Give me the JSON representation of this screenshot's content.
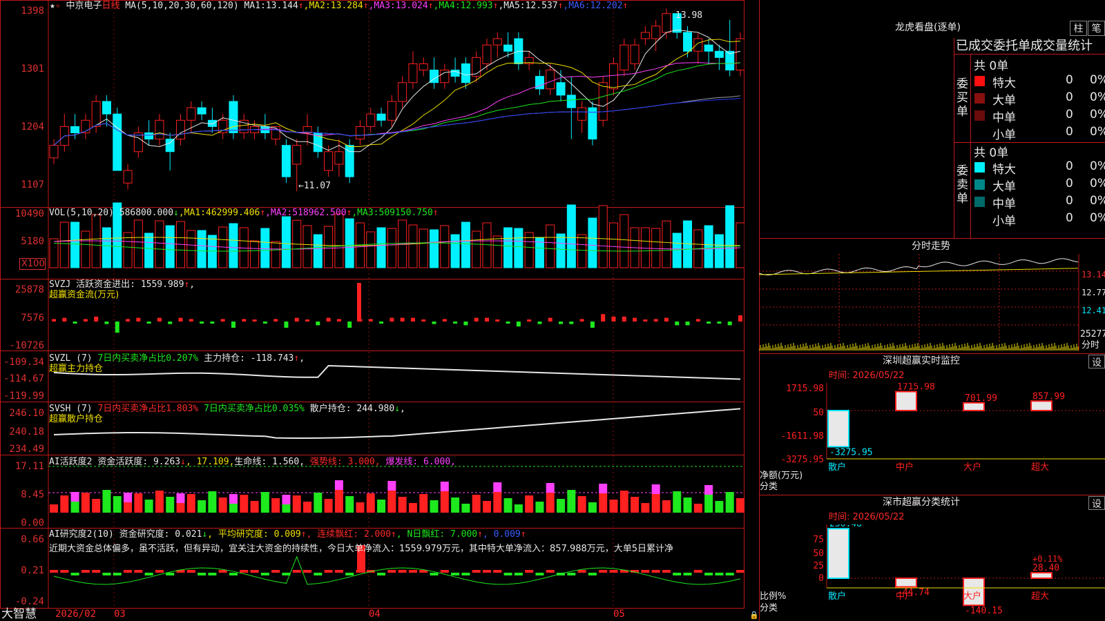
{
  "kline": {
    "stock_name": "中京电子",
    "period": "日线",
    "ma_label": "MA(5,10,20,30,60,120)",
    "ma": [
      {
        "name": "MA1",
        "value": "13.144"
      },
      {
        "name": "MA2",
        "value": "13.284"
      },
      {
        "name": "MA3",
        "value": "13.024"
      },
      {
        "name": "MA4",
        "value": "12.993"
      },
      {
        "name": "MA5",
        "value": "12.537"
      },
      {
        "name": "MA6",
        "value": "12.202"
      }
    ],
    "yticks": [
      "1398",
      "1301",
      "1204",
      "1107"
    ],
    "high_label": "13.98",
    "low_label": "←11.07",
    "candles": [
      {
        "o": 11.6,
        "h": 11.9,
        "l": 11.5,
        "c": 11.8
      },
      {
        "o": 11.8,
        "h": 12.3,
        "l": 11.7,
        "c": 12.1
      },
      {
        "o": 12.1,
        "h": 12.3,
        "l": 11.9,
        "c": 12.0
      },
      {
        "o": 12.0,
        "h": 12.3,
        "l": 11.9,
        "c": 12.2
      },
      {
        "o": 12.1,
        "h": 12.6,
        "l": 12.0,
        "c": 12.5
      },
      {
        "o": 12.5,
        "h": 12.6,
        "l": 12.1,
        "c": 12.3
      },
      {
        "o": 12.3,
        "h": 12.4,
        "l": 11.5,
        "c": 11.4
      },
      {
        "o": 11.2,
        "h": 11.5,
        "l": 11.1,
        "c": 11.4
      },
      {
        "o": 11.7,
        "h": 12.1,
        "l": 11.6,
        "c": 12.0
      },
      {
        "o": 12.0,
        "h": 12.2,
        "l": 11.8,
        "c": 11.9
      },
      {
        "o": 11.9,
        "h": 12.3,
        "l": 11.8,
        "c": 12.2
      },
      {
        "o": 11.9,
        "h": 12.0,
        "l": 11.4,
        "c": 11.7
      },
      {
        "o": 11.9,
        "h": 12.3,
        "l": 11.8,
        "c": 12.2
      },
      {
        "o": 12.2,
        "h": 12.5,
        "l": 12.0,
        "c": 12.4
      },
      {
        "o": 12.4,
        "h": 12.5,
        "l": 12.2,
        "c": 12.3
      },
      {
        "o": 12.2,
        "h": 12.4,
        "l": 12.0,
        "c": 12.1
      },
      {
        "o": 12.0,
        "h": 12.3,
        "l": 11.9,
        "c": 12.2
      },
      {
        "o": 12.5,
        "h": 12.6,
        "l": 11.9,
        "c": 12.0
      },
      {
        "o": 12.0,
        "h": 12.3,
        "l": 11.9,
        "c": 12.2
      },
      {
        "o": 12.0,
        "h": 12.2,
        "l": 11.9,
        "c": 12.1
      },
      {
        "o": 12.1,
        "h": 12.3,
        "l": 11.9,
        "c": 12.0
      },
      {
        "o": 11.9,
        "h": 12.1,
        "l": 11.8,
        "c": 12.1
      },
      {
        "o": 11.8,
        "h": 11.9,
        "l": 11.2,
        "c": 11.3
      },
      {
        "o": 11.5,
        "h": 11.9,
        "l": 11.07,
        "c": 11.8
      },
      {
        "o": 12.0,
        "h": 12.3,
        "l": 11.8,
        "c": 12.1
      },
      {
        "o": 12.0,
        "h": 12.1,
        "l": 11.6,
        "c": 11.7
      },
      {
        "o": 11.4,
        "h": 11.8,
        "l": 11.3,
        "c": 11.7
      },
      {
        "o": 11.5,
        "h": 11.9,
        "l": 11.3,
        "c": 11.7
      },
      {
        "o": 11.8,
        "h": 11.9,
        "l": 11.2,
        "c": 11.3
      },
      {
        "o": 11.9,
        "h": 12.2,
        "l": 11.8,
        "c": 12.1
      },
      {
        "o": 12.1,
        "h": 12.4,
        "l": 12.0,
        "c": 12.3
      },
      {
        "o": 12.3,
        "h": 12.4,
        "l": 12.1,
        "c": 12.2
      },
      {
        "o": 12.2,
        "h": 12.6,
        "l": 12.1,
        "c": 12.5
      },
      {
        "o": 12.5,
        "h": 12.9,
        "l": 12.4,
        "c": 12.8
      },
      {
        "o": 12.8,
        "h": 13.3,
        "l": 12.7,
        "c": 13.1
      },
      {
        "o": 13.0,
        "h": 13.2,
        "l": 12.9,
        "c": 13.1
      },
      {
        "o": 13.0,
        "h": 13.2,
        "l": 12.7,
        "c": 12.8
      },
      {
        "o": 12.8,
        "h": 13.1,
        "l": 12.7,
        "c": 13.0
      },
      {
        "o": 13.0,
        "h": 13.2,
        "l": 12.8,
        "c": 12.9
      },
      {
        "o": 13.1,
        "h": 13.2,
        "l": 12.7,
        "c": 12.8
      },
      {
        "o": 12.9,
        "h": 13.3,
        "l": 12.8,
        "c": 13.2
      },
      {
        "o": 13.1,
        "h": 13.5,
        "l": 13.0,
        "c": 13.4
      },
      {
        "o": 13.4,
        "h": 13.6,
        "l": 13.2,
        "c": 13.5
      },
      {
        "o": 13.4,
        "h": 13.6,
        "l": 13.2,
        "c": 13.3
      },
      {
        "o": 13.5,
        "h": 13.6,
        "l": 13.0,
        "c": 13.1
      },
      {
        "o": 13.1,
        "h": 13.3,
        "l": 13.0,
        "c": 13.2
      },
      {
        "o": 12.9,
        "h": 13.0,
        "l": 12.6,
        "c": 12.7
      },
      {
        "o": 12.7,
        "h": 13.1,
        "l": 12.6,
        "c": 13.0
      },
      {
        "o": 12.8,
        "h": 13.0,
        "l": 12.5,
        "c": 12.6
      },
      {
        "o": 12.6,
        "h": 12.9,
        "l": 11.9,
        "c": 12.4
      },
      {
        "o": 12.2,
        "h": 12.5,
        "l": 12.0,
        "c": 12.4
      },
      {
        "o": 12.4,
        "h": 12.5,
        "l": 11.8,
        "c": 11.9
      },
      {
        "o": 12.2,
        "h": 12.9,
        "l": 12.1,
        "c": 12.8
      },
      {
        "o": 12.7,
        "h": 13.2,
        "l": 12.6,
        "c": 13.1
      },
      {
        "o": 13.0,
        "h": 13.5,
        "l": 12.9,
        "c": 13.4
      },
      {
        "o": 13.1,
        "h": 13.5,
        "l": 13.0,
        "c": 13.4
      },
      {
        "o": 13.5,
        "h": 13.7,
        "l": 13.4,
        "c": 13.6
      },
      {
        "o": 13.5,
        "h": 13.8,
        "l": 13.3,
        "c": 13.7
      },
      {
        "o": 13.6,
        "h": 13.98,
        "l": 13.5,
        "c": 13.9
      },
      {
        "o": 13.9,
        "h": 13.9,
        "l": 13.5,
        "c": 13.6
      },
      {
        "o": 13.6,
        "h": 13.7,
        "l": 13.2,
        "c": 13.3
      },
      {
        "o": 13.3,
        "h": 13.6,
        "l": 13.1,
        "c": 13.5
      },
      {
        "o": 13.4,
        "h": 13.5,
        "l": 13.1,
        "c": 13.3
      },
      {
        "o": 13.3,
        "h": 13.4,
        "l": 13.0,
        "c": 13.2
      },
      {
        "o": 13.3,
        "h": 13.8,
        "l": 12.9,
        "c": 13.0
      },
      {
        "o": 13.0,
        "h": 13.6,
        "l": 12.9,
        "c": 13.5
      }
    ]
  },
  "vol": {
    "label": "VOL(5,10,20)",
    "value": "586800.000",
    "ma": [
      {
        "name": "MA1",
        "value": "462999.406"
      },
      {
        "name": "MA2",
        "value": "518962.500"
      },
      {
        "name": "MA3",
        "value": "509150.750"
      }
    ],
    "yticks": [
      "10490",
      "5180"
    ],
    "unit": "X100"
  },
  "svzj": {
    "name": "SVZJ",
    "item": "活跃资金进出",
    "value": "1559.989",
    "title": "超赢资金流(万元)",
    "yticks": [
      "25878",
      "7576",
      "-10726"
    ]
  },
  "svzl": {
    "name": "SVZL (7)",
    "item1": "7日内买卖净占比",
    "v1": "0.207%",
    "item2": "主力持仓",
    "v2": "-118.743",
    "title": "超赢主力持仓",
    "yticks": [
      "-109.34",
      "-114.67",
      "-119.99"
    ]
  },
  "svsh": {
    "name": "SVSH (7)",
    "item1": "7日内买卖净占比",
    "v1": "1.803%",
    "item2": "7日内买卖净占比",
    "v2": "0.035%",
    "item3": "散户持仓",
    "v3": "244.980",
    "title": "超赢散户持仓",
    "yticks": [
      "246.10",
      "240.18",
      "234.49"
    ]
  },
  "ai1": {
    "name": "AI活跃度2",
    "item1": "资金活跃度",
    "v1": "9.263",
    "v2": "17.109",
    "item3": "生命线",
    "v3": "1.560",
    "item4": "强势线",
    "v4": "3.000",
    "item5": "爆发线",
    "v5": "6.000",
    "yticks": [
      "17.11",
      "8.45",
      "0.00"
    ]
  },
  "ai2": {
    "name": "AI研究度2(10)",
    "item1": "资金研究度",
    "v1": "0.021",
    "item2": "平均研究度",
    "v2": "0.009",
    "item3": "连续飘红",
    "v3": "2.000",
    "item4": "N日飘红",
    "v4": "7.000",
    "v5": "0.009",
    "text": "近期大资金总体偏多，虽不活跃，但有异动，宜关注大资金的持续性，今日大单净流入：1559.979万元，其中特大单净流入：857.988万元，大单5日累计净",
    "yticks": [
      "0.66",
      "0.21",
      "-0.24"
    ]
  },
  "xaxis": {
    "logo": "大智慧",
    "labels": [
      "2026/02",
      "03",
      "04",
      "05"
    ]
  },
  "right": {
    "title": "龙虎看盘(逐单)",
    "btn_bar": "柱",
    "btn_pen": "笔",
    "tabs": "已成交委托单成交量统计",
    "buy": {
      "side": "委买单",
      "total": "共 0单",
      "rows": [
        {
          "name": "特大",
          "count": "0",
          "pct": "0%",
          "color": "#ff1010"
        },
        {
          "name": "大单",
          "count": "0",
          "pct": "0%",
          "color": "#8a1010"
        },
        {
          "name": "中单",
          "count": "0",
          "pct": "0%",
          "color": "#6a0c0c"
        },
        {
          "name": "小单",
          "count": "0",
          "pct": "0%",
          "color": "#000000"
        }
      ]
    },
    "sell": {
      "side": "委卖单",
      "total": "共 0单",
      "rows": [
        {
          "name": "特大",
          "count": "0",
          "pct": "0%",
          "color": "#00f0ff"
        },
        {
          "name": "大单",
          "count": "0",
          "pct": "0%",
          "color": "#008888"
        },
        {
          "name": "中单",
          "count": "0",
          "pct": "0%",
          "color": "#006a6a"
        },
        {
          "name": "小单",
          "count": "0",
          "pct": "0%",
          "color": "#000000"
        }
      ]
    },
    "intraday": {
      "title": "分时走势",
      "yticks": [
        "13.14",
        "12.77",
        "12.41"
      ],
      "vol_tick": "25277",
      "vol_unit": "分时"
    },
    "monitor": {
      "title": "深圳超赢实时监控",
      "btn": "设",
      "time": "时间: 2026/05/22",
      "yticks": [
        "1715.98",
        "50",
        "-1611.98",
        "-3275.95"
      ],
      "ylabel1": "净额(万元)",
      "ylabel2": "分类",
      "bars": [
        {
          "cat": "散户",
          "value": -3275.95,
          "label": "-3275.95"
        },
        {
          "cat": "中户",
          "value": 1715.98,
          "label": "1715.98"
        },
        {
          "cat": "大户",
          "value": 701.99,
          "label": "701.99"
        },
        {
          "cat": "超大",
          "value": 857.99,
          "label": "857.99"
        }
      ]
    },
    "classify": {
      "title": "深市超赢分类统计",
      "btn": "设",
      "time": "时间: 2026/05/22",
      "yticks": [
        "75",
        "50",
        "25",
        "0"
      ],
      "ylabel1": "比例%",
      "ylabel2": "分类",
      "pct_label": "+0.11%",
      "bars": [
        {
          "cat": "散户",
          "value": 256.48,
          "label": "256.48"
        },
        {
          "cat": "中户",
          "value": -44.74,
          "label": "-44.74"
        },
        {
          "cat": "大户",
          "value": -140.15,
          "label": "-140.15"
        },
        {
          "cat": "超大",
          "value": 28.4,
          "label": "28.40"
        }
      ]
    }
  },
  "colors": {
    "up": "#ff2020",
    "down": "#00f0ff",
    "grid": "#c01818",
    "ma1": "#e8e8e8",
    "ma2": "#f0e000",
    "ma3": "#ff40ff",
    "ma4": "#1ee81e",
    "ma5": "#a0a0a0",
    "ma6": "#2a3cff"
  }
}
